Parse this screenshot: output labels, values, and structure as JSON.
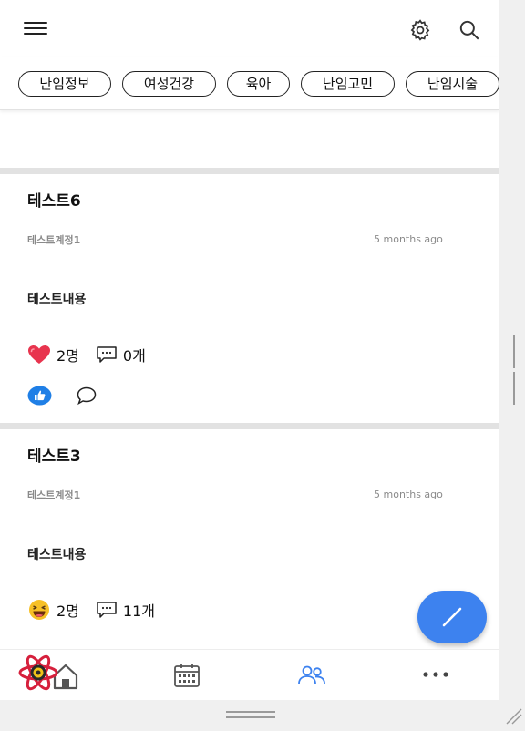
{
  "header": {
    "menu_icon": "hamburger-menu-icon",
    "settings_icon": "gear-icon",
    "search_icon": "search-icon"
  },
  "categories": [
    "난임정보",
    "여성건강",
    "육아",
    "난임고민",
    "난임시술"
  ],
  "posts": [
    {
      "title": "테스트6",
      "author": "테스트계정1",
      "time": "5 months ago",
      "body": "테스트내용",
      "reaction_icon": "heart-icon",
      "likes": "2명",
      "comments": "0개"
    },
    {
      "title": "테스트3",
      "author": "테스트계정1",
      "time": "5 months ago",
      "body": "테스트내용",
      "reaction_icon": "laughing-emoji-icon",
      "likes": "2명",
      "comments": "11개"
    }
  ],
  "nav": [
    "home-icon",
    "calendar-icon",
    "community-icon",
    "more-icon"
  ],
  "colors": {
    "accent": "#3d82ef",
    "heart": "#e8344e",
    "like_button": "#1f7fe6",
    "divider": "#e2e2e2"
  }
}
